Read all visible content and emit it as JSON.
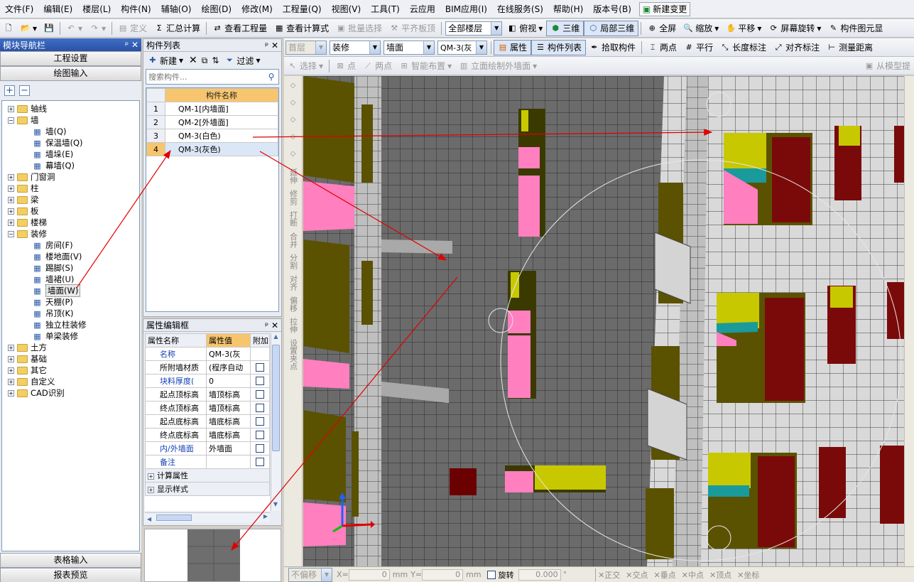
{
  "menu": [
    "文件(F)",
    "编辑(E)",
    "楼层(L)",
    "构件(N)",
    "辅轴(O)",
    "绘图(D)",
    "修改(M)",
    "工程量(Q)",
    "视图(V)",
    "工具(T)",
    "云应用",
    "BIM应用(I)",
    "在线服务(S)",
    "帮助(H)",
    "版本号(B)"
  ],
  "menu_new_change": "新建变更",
  "toolbar1": {
    "define": "定义",
    "sum": "汇总计算",
    "view_qty": "查看工程量",
    "view_formula": "查看计算式",
    "batch_select": "批量选择",
    "flush_board": "平齐板顶",
    "floor_combo": "全部楼层",
    "top_view": "俯视",
    "three_d": "三维",
    "local_3d": "局部三维",
    "fullscreen": "全屏",
    "zoom": "缩放",
    "pan": "平移",
    "rotate": "屏幕旋转",
    "component_pos": "构件图元显"
  },
  "toolbar2": {
    "floor": "首层",
    "category": "装修",
    "type": "墙面",
    "component": "QM-3(灰",
    "property": "属性",
    "component_list": "构件列表",
    "pick": "拾取构件",
    "two_points": "两点",
    "parallel": "平行",
    "length_mark": "长度标注",
    "align_mark": "对齐标注",
    "measure": "测量距离"
  },
  "toolbar3": {
    "select": "选择",
    "point": "点",
    "two_point": "两点",
    "smart": "智能布置",
    "elevation": "立面绘制外墙面",
    "from_model": "从模型提"
  },
  "nav": {
    "title": "模块导航栏",
    "btn_settings": "工程设置",
    "btn_draw": "绘图输入",
    "btn_table": "表格输入",
    "btn_report": "报表预览",
    "tree": [
      {
        "label": "轴线",
        "level": 0,
        "toggle": "+"
      },
      {
        "label": "墙",
        "level": 0,
        "toggle": "-",
        "open": true
      },
      {
        "label": "墙(Q)",
        "level": 1,
        "icon": "wall-icon"
      },
      {
        "label": "保温墙(Q)",
        "level": 1,
        "icon": "insulation-wall-icon"
      },
      {
        "label": "墙垛(E)",
        "level": 1,
        "icon": "wall-pier-icon"
      },
      {
        "label": "幕墙(Q)",
        "level": 1,
        "icon": "curtain-wall-icon"
      },
      {
        "label": "门窗洞",
        "level": 0,
        "toggle": "+"
      },
      {
        "label": "柱",
        "level": 0,
        "toggle": "+"
      },
      {
        "label": "梁",
        "level": 0,
        "toggle": "+"
      },
      {
        "label": "板",
        "level": 0,
        "toggle": "+"
      },
      {
        "label": "楼梯",
        "level": 0,
        "toggle": "+"
      },
      {
        "label": "装修",
        "level": 0,
        "toggle": "-",
        "open": true
      },
      {
        "label": "房间(F)",
        "level": 1,
        "icon": "room-icon"
      },
      {
        "label": "楼地面(V)",
        "level": 1,
        "icon": "floor-icon"
      },
      {
        "label": "踢脚(S)",
        "level": 1,
        "icon": "skirting-icon"
      },
      {
        "label": "墙裙(U)",
        "level": 1,
        "icon": "dado-icon"
      },
      {
        "label": "墙面(W)",
        "level": 1,
        "icon": "wall-surface-icon",
        "selected": true
      },
      {
        "label": "天棚(P)",
        "level": 1,
        "icon": "ceiling-icon"
      },
      {
        "label": "吊顶(K)",
        "level": 1,
        "icon": "suspended-ceiling-icon"
      },
      {
        "label": "独立柱装修",
        "level": 1,
        "icon": "column-finish-icon"
      },
      {
        "label": "单梁装修",
        "level": 1,
        "icon": "beam-finish-icon"
      },
      {
        "label": "土方",
        "level": 0,
        "toggle": "+"
      },
      {
        "label": "基础",
        "level": 0,
        "toggle": "+"
      },
      {
        "label": "其它",
        "level": 0,
        "toggle": "+"
      },
      {
        "label": "自定义",
        "level": 0,
        "toggle": "+"
      },
      {
        "label": "CAD识别",
        "level": 0,
        "toggle": "+"
      }
    ]
  },
  "component_list": {
    "title": "构件列表",
    "new_btn": "新建",
    "filter_btn": "过滤",
    "search_placeholder": "搜索构件...",
    "header": "构件名称",
    "rows": [
      {
        "no": "1",
        "name": "QM-1[内墙面]"
      },
      {
        "no": "2",
        "name": "QM-2[外墙面]"
      },
      {
        "no": "3",
        "name": "QM-3(白色)"
      },
      {
        "no": "4",
        "name": "QM-3(灰色)",
        "selected": true
      }
    ]
  },
  "props": {
    "title": "属性编辑框",
    "headers": [
      "属性名称",
      "属性值",
      "附加"
    ],
    "rows": [
      {
        "name": "名称",
        "value": "QM-3(灰",
        "blue": true,
        "check": false
      },
      {
        "name": "所附墙材质",
        "value": "(程序自动",
        "blue": false,
        "check": true
      },
      {
        "name": "块料厚度(",
        "value": "0",
        "blue": true,
        "check": true
      },
      {
        "name": "起点顶标高",
        "value": "墙顶标高",
        "blue": false,
        "check": true
      },
      {
        "name": "终点顶标高",
        "value": "墙顶标高",
        "blue": false,
        "check": true
      },
      {
        "name": "起点底标高",
        "value": "墙底标高",
        "blue": false,
        "check": true
      },
      {
        "name": "终点底标高",
        "value": "墙底标高",
        "blue": false,
        "check": true
      },
      {
        "name": "内/外墙面",
        "value": "外墙面",
        "blue": true,
        "check": true
      },
      {
        "name": "备注",
        "value": "",
        "blue": true,
        "check": true
      }
    ],
    "groups": [
      "计算属性",
      "显示样式"
    ]
  },
  "left_tools": [
    "延伸",
    "修剪",
    "打断",
    "合并",
    "分割",
    "对齐",
    "偏移",
    "拉伸",
    "设置夹点"
  ],
  "status": {
    "offset": "不偏移",
    "x_label": "X=",
    "x_val": "0",
    "y_label": "Y=",
    "y_val": "0",
    "unit": "mm",
    "rotate": "旋转",
    "angle": "0.000",
    "snaps": [
      "正交",
      "交点",
      "垂点",
      "中点",
      "顶点",
      "坐标"
    ]
  },
  "colors": {
    "title_blue": "#2a52a6",
    "wall_gray": "#6b6b6b",
    "wall_light": "#d8d8d8",
    "window_yellow": "#c8c800",
    "window_pink": "#ff7fbf",
    "window_maroon": "#7a0a0a",
    "arrow_red": "#e00000"
  }
}
